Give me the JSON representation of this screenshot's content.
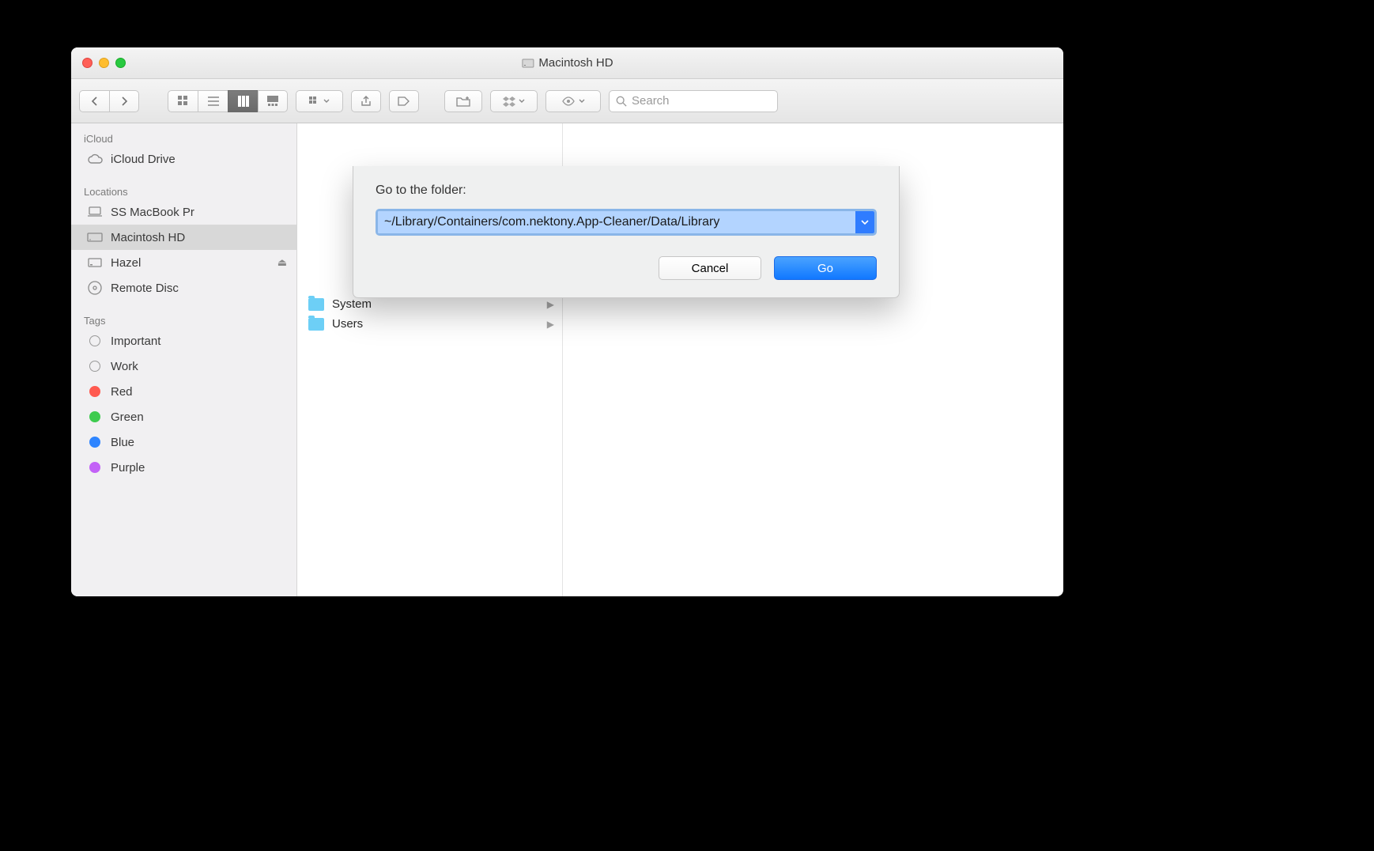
{
  "window": {
    "title": "Macintosh HD"
  },
  "toolbar": {
    "search_placeholder": "Search"
  },
  "sidebar": {
    "sections": {
      "icloud": "iCloud",
      "locations": "Locations",
      "tags": "Tags"
    },
    "icloud_drive": "iCloud Drive",
    "locations_items": [
      {
        "label": "SS MacBook Pr",
        "icon": "laptop"
      },
      {
        "label": "Macintosh HD",
        "icon": "hd",
        "selected": true
      },
      {
        "label": "Hazel",
        "icon": "external",
        "eject": true
      },
      {
        "label": "Remote Disc",
        "icon": "disc"
      }
    ],
    "tags": [
      {
        "label": "Important",
        "color": ""
      },
      {
        "label": "Work",
        "color": ""
      },
      {
        "label": "Red",
        "color": "#ff5a50"
      },
      {
        "label": "Green",
        "color": "#3ecb4f"
      },
      {
        "label": "Blue",
        "color": "#2f85ff"
      },
      {
        "label": "Purple",
        "color": "#c362f7"
      }
    ]
  },
  "content": {
    "col1": [
      {
        "label": "System"
      },
      {
        "label": "Users"
      }
    ]
  },
  "dialog": {
    "label": "Go to the folder:",
    "path": "~/Library/Containers/com.nektony.App-Cleaner/Data/Library",
    "cancel": "Cancel",
    "go": "Go"
  }
}
